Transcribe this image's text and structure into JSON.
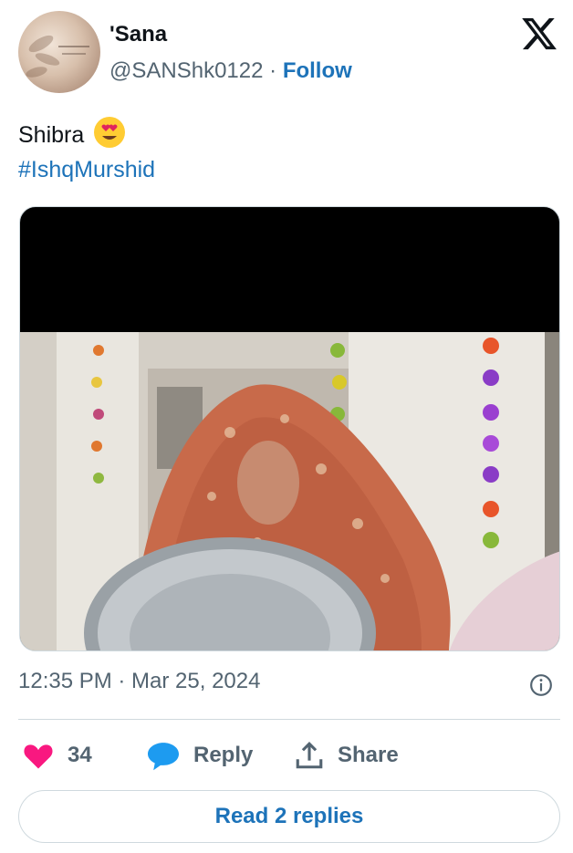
{
  "author": {
    "display_name": "'Sana",
    "handle": "@SANShk0122",
    "separator": "·",
    "follow_label": "Follow"
  },
  "platform_icon": "x-logo-icon",
  "tweet": {
    "text": "Shibra",
    "emoji": "heart-eyes-emoji-icon",
    "hashtag": "#IshqMurshid"
  },
  "media": {
    "type": "video-still",
    "description_icon": "video-thumbnail"
  },
  "meta": {
    "timestamp": "12:35 PM · Mar 25, 2024",
    "info_icon": "info-icon"
  },
  "actions": {
    "like_count": "34",
    "reply_label": "Reply",
    "share_label": "Share",
    "like_color": "#f91880",
    "reply_color": "#1d9bf0"
  },
  "footer": {
    "read_replies_label": "Read 2 replies"
  }
}
